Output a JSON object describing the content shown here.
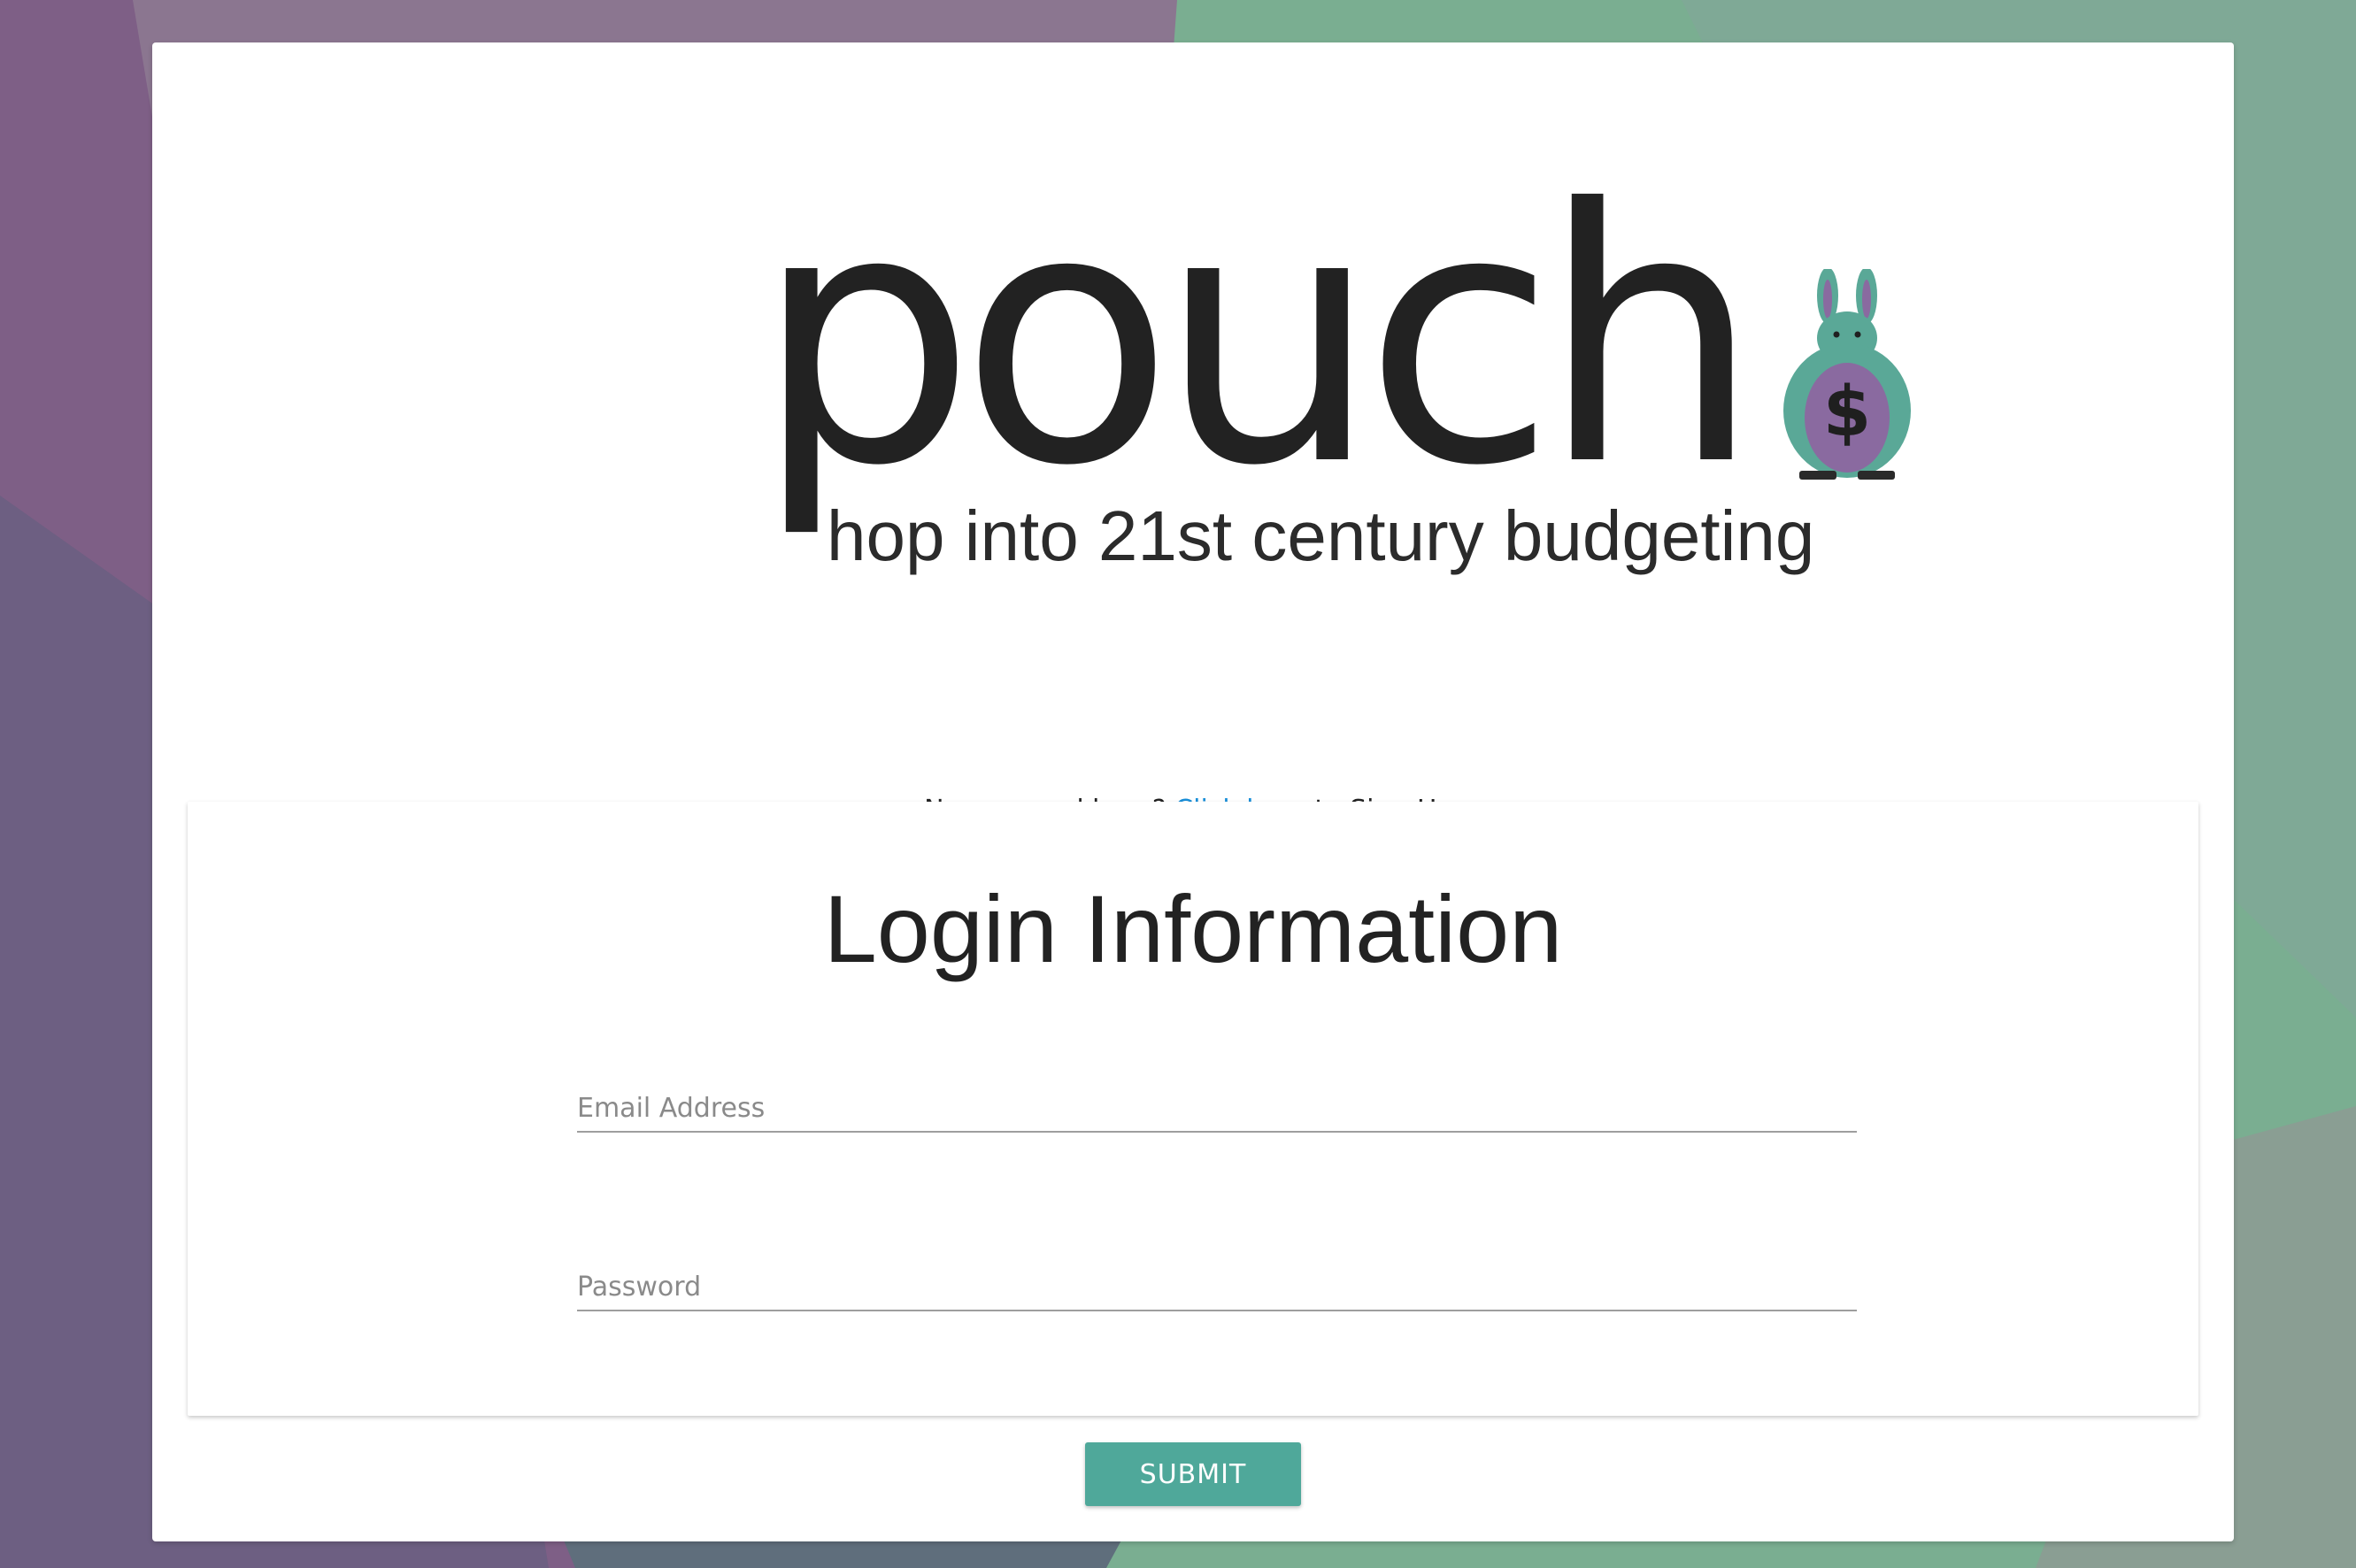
{
  "colors": {
    "background_purple": "#7e5f86",
    "background_green": "#7ab08f",
    "card_bg": "#ffffff",
    "link": "#1a8fd8",
    "button_bg": "#4fa89a",
    "button_text": "#ffffff",
    "mascot_body": "#5aa897",
    "mascot_pouch": "#8a6aa0"
  },
  "logo": {
    "wordmark": "pouch",
    "tagline": "hop into 21st century budgeting",
    "mascot_icon": "kangaroo-dollar-icon"
  },
  "signup": {
    "prefix": "New around here? ",
    "link_text": "Click here",
    "suffix": " to Sign-Up."
  },
  "login_form": {
    "title": "Login Information",
    "email_placeholder": "Email Address",
    "email_value": "",
    "password_placeholder": "Password",
    "password_value": ""
  },
  "submit": {
    "label": "SUBMIT"
  }
}
